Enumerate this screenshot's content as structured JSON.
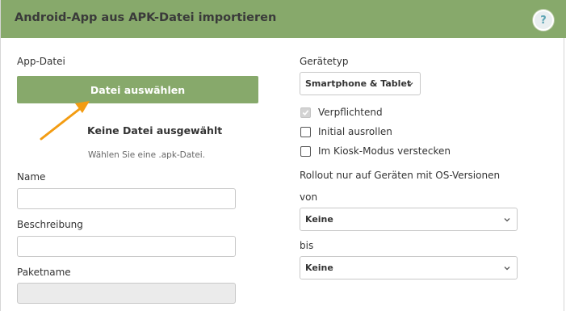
{
  "dialog": {
    "title": "Android-App aus APK-Datei importieren",
    "help_label": "?"
  },
  "file": {
    "label": "App-Datei",
    "button_label": "Datei auswählen",
    "status": "Keine Datei ausgewählt",
    "hint": "Wählen Sie eine .apk-Datei."
  },
  "fields": {
    "name_label": "Name",
    "description_label": "Beschreibung",
    "package_label": "Paketname"
  },
  "device": {
    "label": "Gerätetyp",
    "selected": "Smartphone & Tablet"
  },
  "options": {
    "mandatory": "Verpflichtend",
    "initial_rollout": "Initial ausrollen",
    "hide_kiosk": "Im Kiosk-Modus verstecken"
  },
  "rollout": {
    "label": "Rollout nur auf Geräten mit OS-Versionen",
    "from_label": "von",
    "from_value": "Keine",
    "to_label": "bis",
    "to_value": "Keine"
  },
  "colors": {
    "header": "#87a96b",
    "button": "#87a96b",
    "arrow": "#f39c12"
  }
}
